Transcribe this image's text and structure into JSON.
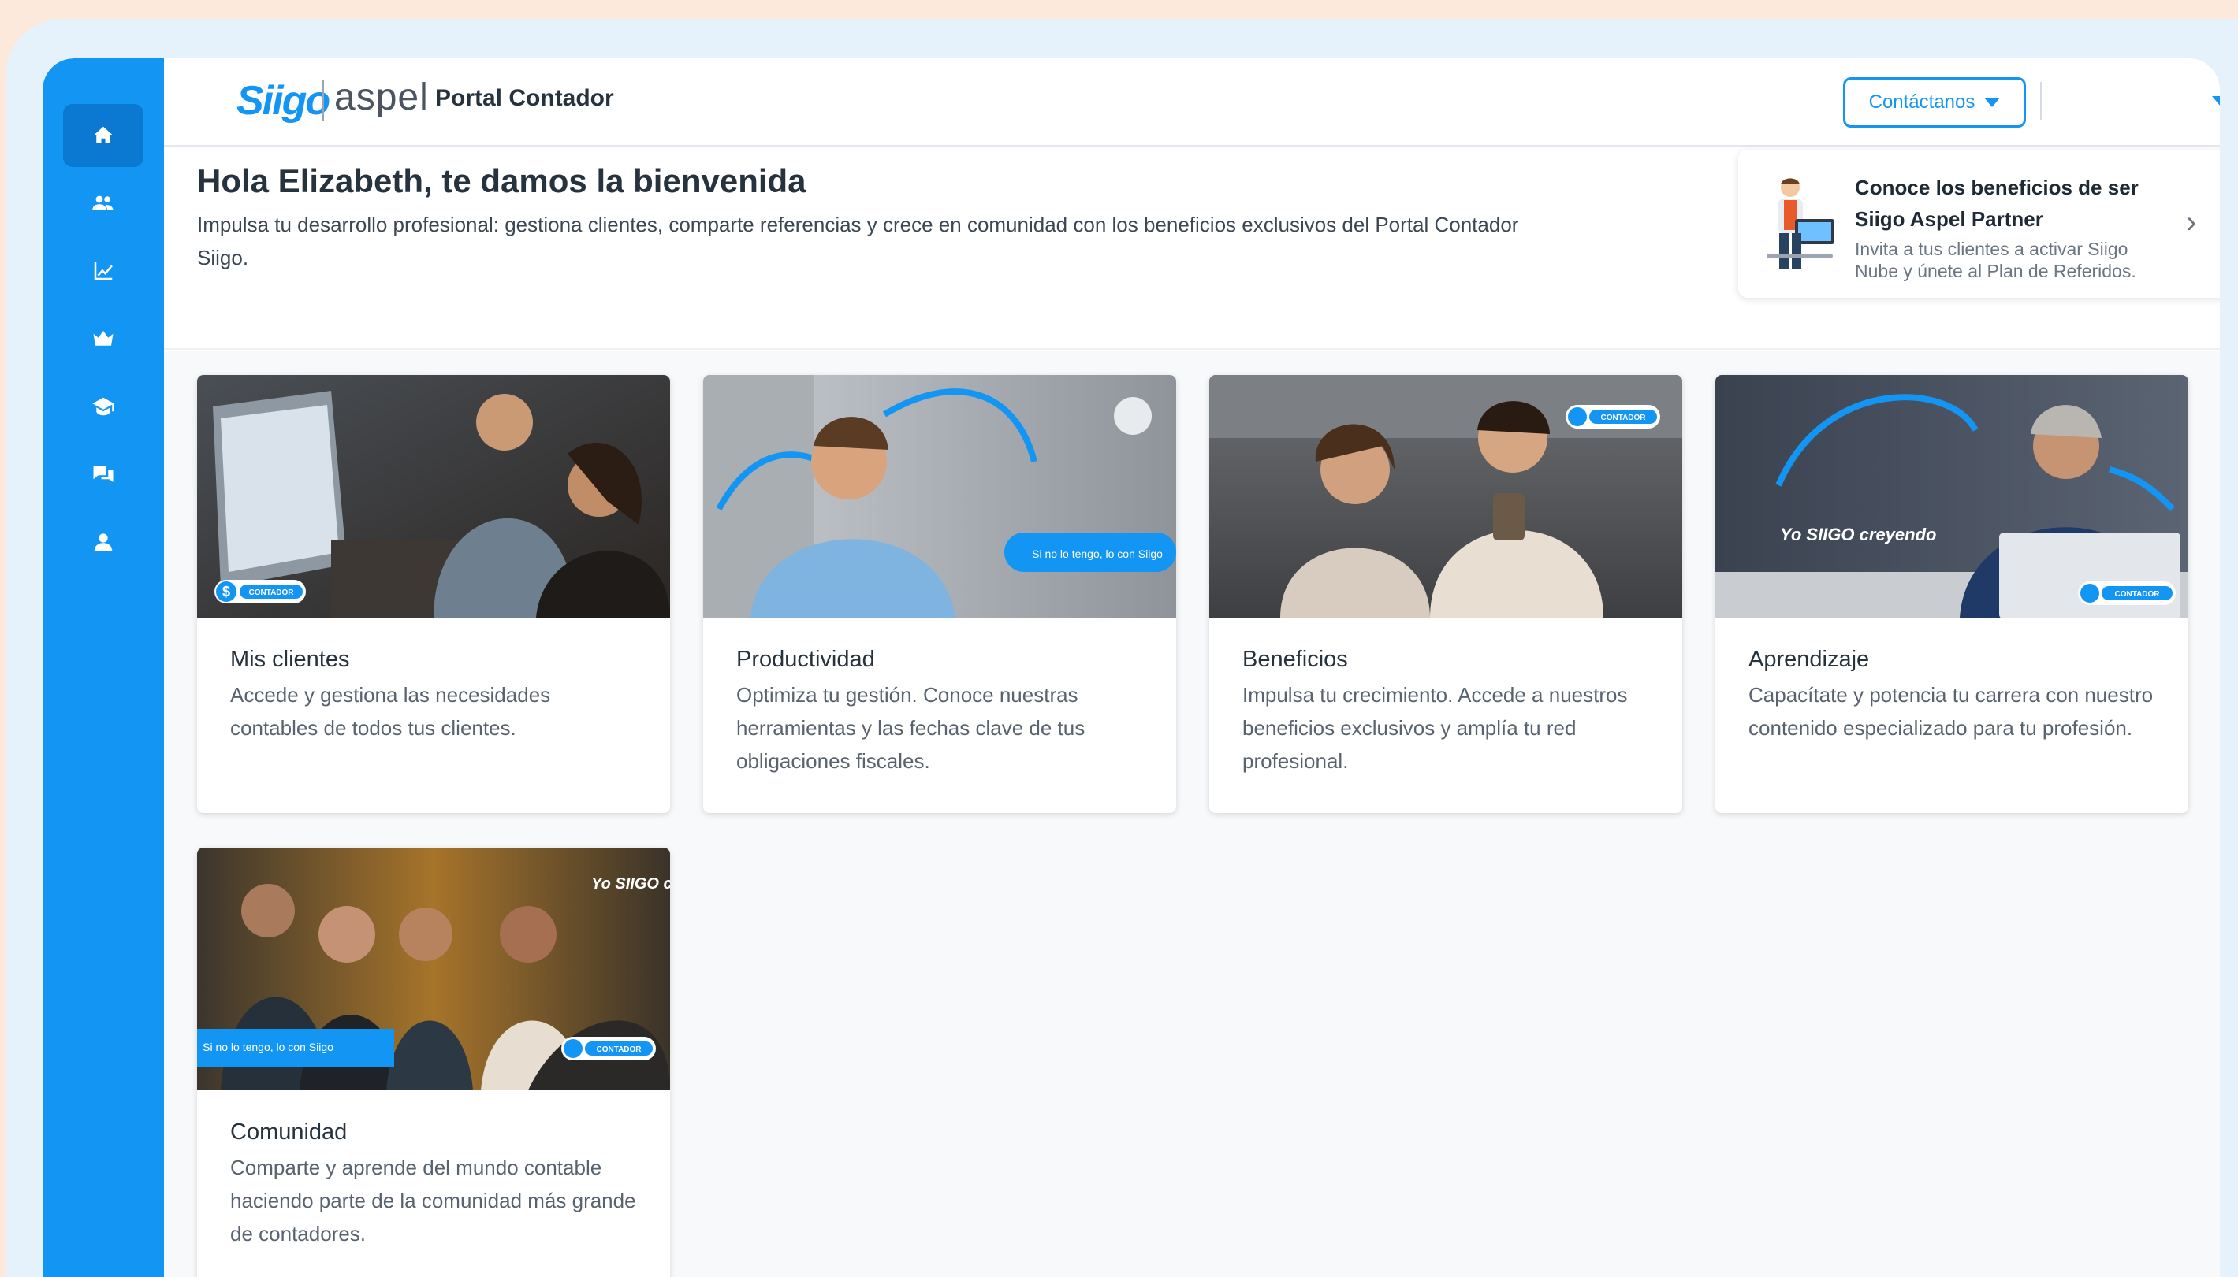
{
  "header": {
    "logo_siigo": "Siigo",
    "logo_aspel": "aspel",
    "portal_title": "Portal Contador",
    "contact_button": "Contáctanos"
  },
  "sidebar": {
    "items": [
      {
        "icon": "home-icon",
        "active": true
      },
      {
        "icon": "users-icon"
      },
      {
        "icon": "chart-icon"
      },
      {
        "icon": "crown-icon"
      },
      {
        "icon": "graduation-cap-icon"
      },
      {
        "icon": "chat-icon"
      },
      {
        "icon": "user-icon"
      }
    ]
  },
  "welcome": {
    "title": "Hola Elizabeth, te damos la bienvenida",
    "text": "Impulsa tu desarrollo profesional: gestiona clientes, comparte referencias y crece en comunidad con los beneficios exclusivos del Portal Contador Siigo."
  },
  "promo": {
    "title": "Conoce los beneficios de ser Siigo Aspel Partner",
    "subtitle": "Invita a tus clientes a activar Siigo Nube y únete al Plan de Referidos."
  },
  "cards": [
    {
      "title": "Mis clientes",
      "description": "Accede y gestiona las necesidades contables de todos tus clientes.",
      "badge": "CONTADOR"
    },
    {
      "title": "Productividad",
      "description": "Optimiza tu gestión. Conoce nuestras herramientas y las fechas clave de tus obligaciones fiscales.",
      "banner": "Si no lo tengo, lo con Siigo"
    },
    {
      "title": "Beneficios",
      "description": "Impulsa tu crecimiento. Accede a nuestros beneficios exclusivos y amplía tu red profesional.",
      "badge": "CONTADOR"
    },
    {
      "title": "Aprendizaje",
      "description": "Capacítate y potencia tu carrera con nuestro contenido especializado para tu profesión.",
      "badge": "CONTADOR",
      "logo": "Yo SIIGO creyendo"
    },
    {
      "title": "Comunidad",
      "description": "Comparte y aprende del mundo contable haciendo parte de la comunidad más grande de contadores.",
      "badge": "CONTADOR",
      "banner": "Si no lo tengo, lo con Siigo",
      "logo": "Yo SIIGO creyendo"
    }
  ],
  "colors": {
    "primary": "#1396f3",
    "sidebar_active": "#0b78d1",
    "background": "#fde9dc"
  }
}
